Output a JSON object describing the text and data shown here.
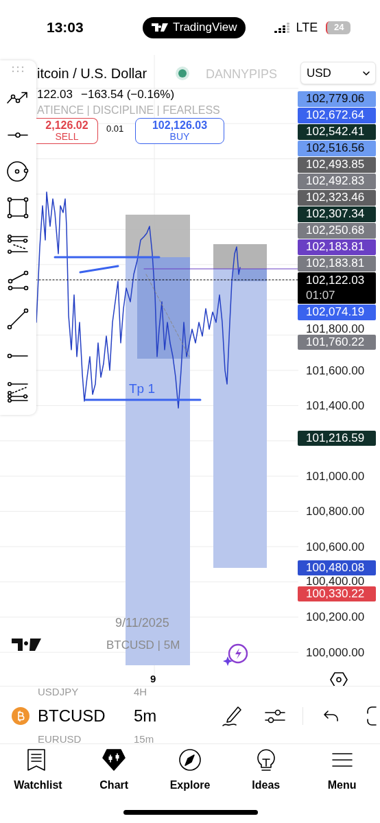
{
  "status_bar": {
    "time": "13:03",
    "app_pill": "TradingView",
    "network": "LTE",
    "battery": "24"
  },
  "chart": {
    "symbol_title": "itcoin / U.S. Dollar",
    "market_open": true,
    "quote": "122.03",
    "change": "−163.54 (−0.16%)",
    "watermark_name": "DANNYPIPS",
    "watermark_slogan": "ATIENCE | DISCIPLINE | FEARLESS",
    "sell": {
      "price": "2,126.02",
      "label": "SELL"
    },
    "spread": "0.01",
    "buy": {
      "price": "102,126.03",
      "label": "BUY"
    },
    "currency": "USD",
    "drawing_label": "Tp 1",
    "date_watermark": "9/11/2025",
    "symbol_watermark": "BTCUSD | 5M",
    "x_label": "9"
  },
  "price_tags": [
    {
      "text": "102,779.06",
      "color": "#6d9bf1"
    },
    {
      "text": "102,672.64",
      "color": "#3a63ee"
    },
    {
      "text": "102,542.41",
      "color": "#10302a"
    },
    {
      "text": "102,516.56",
      "color": "#6d9bf1"
    },
    {
      "text": "102,493.85",
      "color": "#5f5f61"
    },
    {
      "text": "102,492.83",
      "color": "#7a7b82"
    },
    {
      "text": "102,323.46",
      "color": "#5f5f61"
    },
    {
      "text": "102,307.34",
      "color": "#10302a"
    },
    {
      "text": "102,250.68",
      "color": "#7a7b82"
    },
    {
      "text": "102,183.81",
      "color": "#6a3fc4"
    },
    {
      "text": "102,183.81",
      "color": "#7a7b82"
    },
    {
      "text": "102,122.03",
      "countdown": "01:07",
      "color": "#000000"
    },
    {
      "text": "102,074.19",
      "color": "#3a63ee"
    }
  ],
  "axis_labels": [
    {
      "kind": "tick",
      "text": "101,800.00"
    },
    {
      "kind": "tag",
      "text": "101,760.22",
      "color": "#7a7b82"
    },
    {
      "kind": "tick",
      "text": "101,600.00"
    },
    {
      "kind": "tick",
      "text": "101,400.00"
    },
    {
      "kind": "tag",
      "text": "101,216.59",
      "color": "#10302a"
    },
    {
      "kind": "tick",
      "text": "101,000.00"
    },
    {
      "kind": "tick",
      "text": "100,800.00"
    },
    {
      "kind": "tick",
      "text": "100,600.00"
    },
    {
      "kind": "tag",
      "text": "100,480.08",
      "color": "#2e4fd0"
    },
    {
      "kind": "tick",
      "text": "100,400.00"
    },
    {
      "kind": "tag",
      "text": "100,330.22",
      "color": "#e0434b"
    },
    {
      "kind": "tick",
      "text": "100,200.00"
    },
    {
      "kind": "tick",
      "text": "100,000.00"
    }
  ],
  "symbol_picker": [
    {
      "symbol": "USDJPY",
      "interval": "4H",
      "selected": false
    },
    {
      "symbol": "BTCUSD",
      "interval": "5m",
      "selected": true
    },
    {
      "symbol": "EURUSD",
      "interval": "15m",
      "selected": false
    }
  ],
  "tabs": [
    {
      "label": "Watchlist",
      "kind": "watchlist"
    },
    {
      "label": "Chart",
      "kind": "chart"
    },
    {
      "label": "Explore",
      "kind": "explore"
    },
    {
      "label": "Ideas",
      "kind": "ideas"
    },
    {
      "label": "Menu",
      "kind": "menu"
    }
  ]
}
